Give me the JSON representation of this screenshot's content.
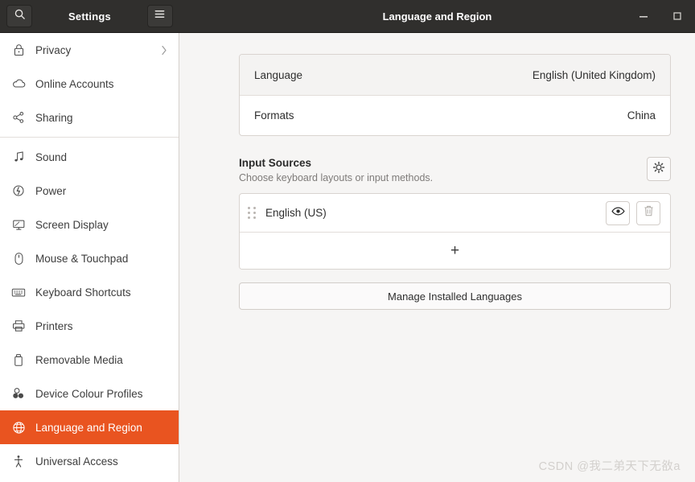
{
  "window": {
    "app_title": "Settings",
    "page_title": "Language and Region",
    "search_icon": "search-icon",
    "menu_icon": "hamburger-menu-icon",
    "minimize_icon": "minimize-icon",
    "maximize_icon": "maximize-icon"
  },
  "colors": {
    "accent": "#E95420",
    "titlebar": "#302F2D",
    "main_bg": "#F6F5F4",
    "card_bg": "#FFFFFF",
    "border": "#D9D4D0"
  },
  "sidebar": {
    "items": [
      {
        "label": "Privacy",
        "icon": "lock-icon",
        "selected": false,
        "chevron": "›"
      },
      {
        "label": "Online Accounts",
        "icon": "cloud-icon",
        "selected": false
      },
      {
        "label": "Sharing",
        "icon": "share-nodes-icon",
        "selected": false
      },
      {
        "label": "Sound",
        "icon": "music-note-icon",
        "selected": false,
        "separator_before": true
      },
      {
        "label": "Power",
        "icon": "power-bolt-icon",
        "selected": false
      },
      {
        "label": "Screen Display",
        "icon": "monitor-icon",
        "selected": false
      },
      {
        "label": "Mouse & Touchpad",
        "icon": "mouse-icon",
        "selected": false
      },
      {
        "label": "Keyboard Shortcuts",
        "icon": "keyboard-icon",
        "selected": false
      },
      {
        "label": "Printers",
        "icon": "printer-icon",
        "selected": false
      },
      {
        "label": "Removable Media",
        "icon": "usb-drive-icon",
        "selected": false
      },
      {
        "label": "Device Colour Profiles",
        "icon": "colour-profiles-icon",
        "selected": false
      },
      {
        "label": "Language and Region",
        "icon": "globe-icon",
        "selected": true
      },
      {
        "label": "Universal Access",
        "icon": "accessibility-icon",
        "selected": false
      }
    ]
  },
  "main": {
    "language_rows": [
      {
        "label": "Language",
        "value": "English (United Kingdom)"
      },
      {
        "label": "Formats",
        "value": "China"
      }
    ],
    "input_sources": {
      "title": "Input Sources",
      "subtitle": "Choose keyboard layouts or input methods.",
      "options_icon": "gear-icon",
      "sources": [
        {
          "name": "English (US)",
          "drag_handle_icon": "drag-handle-icon",
          "preview_icon": "eye-icon",
          "remove_icon": "trash-icon",
          "remove_disabled": true
        }
      ],
      "add_label": "+"
    },
    "manage_button": "Manage Installed Languages"
  },
  "watermark": "CSDN @我二弟天下无敋a"
}
